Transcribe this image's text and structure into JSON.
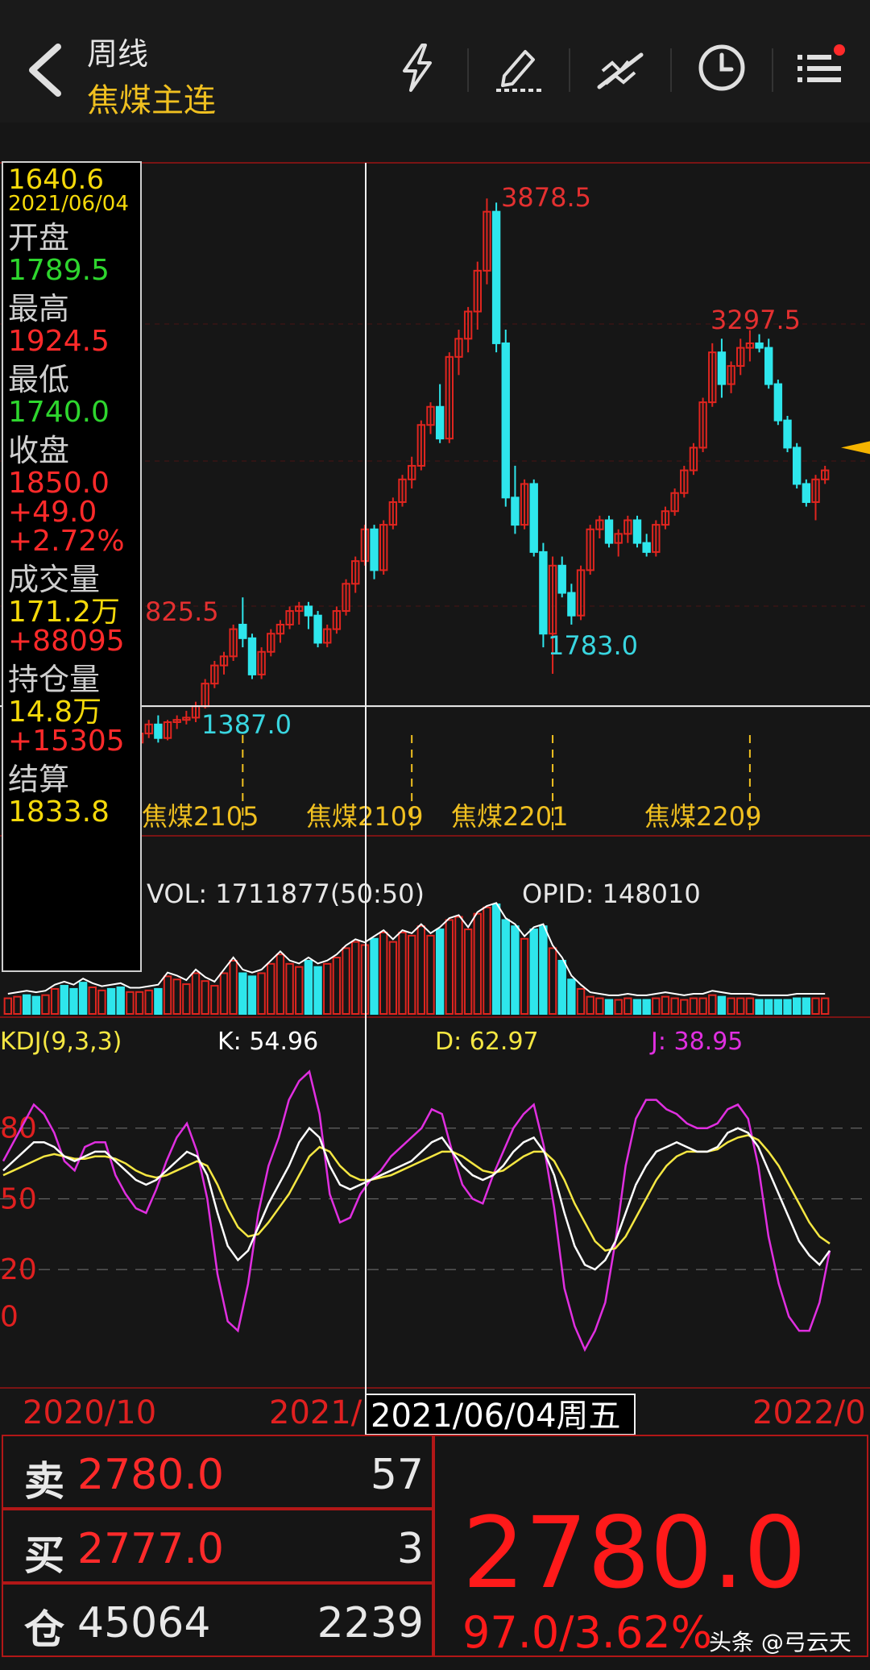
{
  "header": {
    "period": "周线",
    "symbol": "焦煤主连"
  },
  "toolbar": [
    "lightning-icon",
    "draw-pen-icon",
    "trend-line-icon",
    "clock-icon",
    "menu-list-icon"
  ],
  "info_panel": {
    "price": "1640.6",
    "date": "2021/06/04",
    "open_label": "开盘",
    "open": "1789.5",
    "high_label": "最高",
    "high": "1924.5",
    "low_label": "最低",
    "low": "1740.0",
    "close_label": "收盘",
    "close": "1850.0",
    "change": "+49.0",
    "change_pct": "+2.72%",
    "volume_label": "成交量",
    "volume": "171.2万",
    "volume_change": "+88095",
    "oi_label": "持仓量",
    "oi": "14.8万",
    "oi_change": "+15305",
    "settle_label": "结算",
    "settle": "1833.8"
  },
  "colors": {
    "up": "#e0251f",
    "down": "#2ee6ec",
    "k": "#ffffff",
    "d": "#f5e742",
    "j": "#e02fe0",
    "accent": "#f0c020"
  },
  "chart_data": {
    "type": "candlestick",
    "price_labels": {
      "high_1": "3878.5",
      "high_2": "3297.5",
      "low_1": "1387.0",
      "low_2": "1783.0",
      "left_high": "825.5"
    },
    "contract_labels": [
      "焦煤2105",
      "焦煤2109",
      "焦煤2201",
      "焦煤2209"
    ],
    "candles": [
      [
        1560,
        1620,
        1530,
        1600
      ],
      [
        1600,
        1680,
        1580,
        1660
      ],
      [
        1660,
        1700,
        1600,
        1620
      ],
      [
        1620,
        1640,
        1560,
        1580
      ],
      [
        1580,
        1660,
        1560,
        1640
      ],
      [
        1640,
        1800,
        1620,
        1780
      ],
      [
        1780,
        1825,
        1720,
        1740
      ],
      [
        1740,
        1760,
        1640,
        1660
      ],
      [
        1660,
        1680,
        1480,
        1520
      ],
      [
        1520,
        1560,
        1460,
        1540
      ],
      [
        1540,
        1580,
        1500,
        1560
      ],
      [
        1560,
        1600,
        1520,
        1540
      ],
      [
        1540,
        1560,
        1440,
        1460
      ],
      [
        1460,
        1500,
        1387,
        1480
      ],
      [
        1480,
        1540,
        1460,
        1520
      ],
      [
        1520,
        1580,
        1500,
        1560
      ],
      [
        1560,
        1600,
        1480,
        1500
      ],
      [
        1500,
        1580,
        1490,
        1570
      ],
      [
        1570,
        1600,
        1540,
        1580
      ],
      [
        1580,
        1620,
        1560,
        1590
      ],
      [
        1590,
        1660,
        1570,
        1640
      ],
      [
        1640,
        1760,
        1630,
        1740
      ],
      [
        1740,
        1840,
        1720,
        1820
      ],
      [
        1820,
        1880,
        1780,
        1860
      ],
      [
        1860,
        2000,
        1840,
        1980
      ],
      [
        2000,
        2120,
        1900,
        1940
      ],
      [
        1940,
        1960,
        1760,
        1780
      ],
      [
        1780,
        1900,
        1760,
        1880
      ],
      [
        1880,
        1980,
        1860,
        1960
      ],
      [
        1960,
        2020,
        1920,
        2000
      ],
      [
        2000,
        2080,
        1980,
        2060
      ],
      [
        2060,
        2100,
        2000,
        2080
      ],
      [
        2080,
        2100,
        1980,
        2040
      ],
      [
        2040,
        2060,
        1900,
        1920
      ],
      [
        1920,
        2000,
        1900,
        1980
      ],
      [
        1980,
        2080,
        1960,
        2060
      ],
      [
        2060,
        2200,
        2040,
        2180
      ],
      [
        2180,
        2300,
        2140,
        2280
      ],
      [
        2280,
        2440,
        2260,
        2420
      ],
      [
        2420,
        2440,
        2200,
        2240
      ],
      [
        2240,
        2460,
        2220,
        2440
      ],
      [
        2440,
        2560,
        2420,
        2540
      ],
      [
        2540,
        2660,
        2520,
        2640
      ],
      [
        2640,
        2740,
        2600,
        2700
      ],
      [
        2700,
        2900,
        2680,
        2880
      ],
      [
        2880,
        2980,
        2840,
        2960
      ],
      [
        2960,
        3060,
        2800,
        2820
      ],
      [
        2820,
        3200,
        2800,
        3180
      ],
      [
        3180,
        3300,
        3100,
        3260
      ],
      [
        3260,
        3400,
        3200,
        3380
      ],
      [
        3380,
        3600,
        3300,
        3560
      ],
      [
        3560,
        3878.5,
        3500,
        3820
      ],
      [
        3820,
        3860,
        3200,
        3240
      ],
      [
        3240,
        3300,
        2520,
        2560
      ],
      [
        2560,
        2700,
        2400,
        2440
      ],
      [
        2440,
        2640,
        2420,
        2620
      ],
      [
        2620,
        2640,
        2300,
        2320
      ],
      [
        2320,
        2360,
        1900,
        1960
      ],
      [
        1960,
        2300,
        1783,
        2260
      ],
      [
        2260,
        2300,
        2120,
        2140
      ],
      [
        2140,
        2180,
        2000,
        2040
      ],
      [
        2040,
        2260,
        2020,
        2240
      ],
      [
        2240,
        2440,
        2220,
        2420
      ],
      [
        2420,
        2480,
        2380,
        2460
      ],
      [
        2460,
        2480,
        2340,
        2360
      ],
      [
        2360,
        2420,
        2300,
        2400
      ],
      [
        2400,
        2480,
        2360,
        2460
      ],
      [
        2460,
        2480,
        2340,
        2360
      ],
      [
        2360,
        2400,
        2300,
        2320
      ],
      [
        2320,
        2460,
        2300,
        2440
      ],
      [
        2440,
        2520,
        2420,
        2500
      ],
      [
        2500,
        2600,
        2480,
        2580
      ],
      [
        2580,
        2700,
        2560,
        2680
      ],
      [
        2680,
        2800,
        2660,
        2780
      ],
      [
        2780,
        3000,
        2760,
        2980
      ],
      [
        2980,
        3240,
        2960,
        3200
      ],
      [
        3200,
        3260,
        3000,
        3060
      ],
      [
        3060,
        3160,
        3020,
        3140
      ],
      [
        3140,
        3260,
        3100,
        3220
      ],
      [
        3220,
        3297.5,
        3160,
        3240
      ],
      [
        3240,
        3280,
        3200,
        3220
      ],
      [
        3220,
        3260,
        3040,
        3060
      ],
      [
        3060,
        3080,
        2880,
        2900
      ],
      [
        2900,
        2920,
        2760,
        2780
      ],
      [
        2780,
        2800,
        2600,
        2620
      ],
      [
        2620,
        2640,
        2520,
        2540
      ],
      [
        2540,
        2660,
        2460,
        2640
      ],
      [
        2640,
        2700,
        2620,
        2680
      ]
    ],
    "price_ylim": [
      1300,
      4000
    ],
    "current_price": 2780.0,
    "volume_legend": "VOL: 1711877(50:50)",
    "opid_legend": "OPID: 148010",
    "volume": [
      1,
      1.1,
      1.2,
      1.1,
      1.2,
      1.6,
      1.8,
      1.6,
      2,
      1.7,
      1.5,
      1.6,
      1.7,
      1.4,
      1.4,
      1.5,
      1.6,
      2.4,
      2.2,
      1.9,
      2.6,
      2.1,
      1.8,
      2.6,
      3.4,
      2.6,
      2.4,
      2.6,
      3.2,
      3.8,
      3.2,
      3.0,
      3.4,
      3.0,
      3.2,
      3.6,
      4.2,
      4.6,
      4.4,
      4.8,
      5.2,
      4.6,
      5.2,
      5.0,
      5.6,
      5.0,
      5.4,
      6.0,
      6.2,
      5.4,
      6.4,
      6.8,
      7.0,
      6.0,
      5.6,
      4.8,
      5.4,
      5.6,
      4.2,
      3.4,
      2.2,
      1.6,
      1.1,
      1.0,
      0.9,
      0.9,
      1.0,
      0.9,
      0.9,
      1.0,
      1.1,
      1.0,
      0.9,
      1.0,
      1.0,
      1.2,
      1.1,
      1.0,
      1.0,
      1.0,
      0.9,
      0.9,
      0.9,
      0.9,
      1.0,
      1.0,
      1.0,
      1.0
    ],
    "kdj_legend": "KDJ(9,3,3)",
    "k_label": "K: 54.96",
    "d_label": "D: 62.97",
    "j_label": "J: 38.95",
    "kdj_ticks": [
      "80",
      "50",
      "20",
      "0"
    ],
    "k": [
      62,
      66,
      70,
      74,
      74,
      72,
      68,
      66,
      68,
      70,
      70,
      66,
      62,
      58,
      56,
      58,
      62,
      66,
      70,
      68,
      60,
      44,
      30,
      24,
      28,
      38,
      48,
      56,
      64,
      74,
      80,
      76,
      64,
      56,
      54,
      56,
      58,
      60,
      62,
      64,
      66,
      70,
      74,
      76,
      70,
      64,
      60,
      58,
      60,
      64,
      70,
      74,
      76,
      70,
      60,
      44,
      30,
      22,
      20,
      24,
      32,
      44,
      56,
      64,
      70,
      72,
      74,
      72,
      70,
      70,
      72,
      78,
      80,
      78,
      72,
      62,
      52,
      42,
      32,
      26,
      22,
      28
    ],
    "d": [
      60,
      62,
      64,
      66,
      68,
      69,
      68,
      67,
      67,
      68,
      68,
      67,
      65,
      62,
      60,
      59,
      60,
      62,
      64,
      66,
      64,
      56,
      46,
      38,
      34,
      35,
      40,
      46,
      52,
      60,
      68,
      72,
      70,
      64,
      60,
      58,
      58,
      59,
      60,
      62,
      64,
      66,
      68,
      70,
      70,
      68,
      65,
      62,
      61,
      62,
      65,
      68,
      70,
      70,
      66,
      58,
      48,
      40,
      32,
      28,
      29,
      34,
      42,
      50,
      58,
      64,
      68,
      70,
      70,
      70,
      71,
      74,
      76,
      77,
      75,
      70,
      64,
      56,
      48,
      40,
      34,
      31
    ],
    "j": [
      66,
      74,
      82,
      90,
      86,
      78,
      66,
      62,
      72,
      74,
      74,
      60,
      52,
      46,
      44,
      54,
      66,
      76,
      82,
      70,
      50,
      18,
      -2,
      -6,
      14,
      44,
      64,
      76,
      92,
      100,
      104,
      86,
      52,
      40,
      42,
      52,
      58,
      62,
      68,
      72,
      76,
      80,
      88,
      86,
      70,
      56,
      50,
      48,
      60,
      70,
      80,
      86,
      90,
      72,
      46,
      12,
      -4,
      -14,
      -6,
      6,
      32,
      64,
      84,
      92,
      92,
      88,
      86,
      82,
      80,
      80,
      82,
      88,
      90,
      84,
      64,
      34,
      14,
      0,
      -6,
      -6,
      6,
      28
    ],
    "kdj_ylim": [
      -20,
      110
    ],
    "x_labels": [
      "2020/10",
      "2021/",
      "2022/0"
    ],
    "crosshair_date": "2021/06/04周五",
    "crosshair_index": 29
  },
  "orderbook": {
    "sell_label": "卖",
    "sell_price": "2780.0",
    "sell_qty": "57",
    "buy_label": "买",
    "buy_price": "2777.0",
    "buy_qty": "3",
    "oi_label": "仓",
    "oi_value": "45064",
    "oi_qty": "2239",
    "last_price": "2780.0",
    "change": "97.0/3.62%"
  },
  "watermark": "头条 @弓云天"
}
